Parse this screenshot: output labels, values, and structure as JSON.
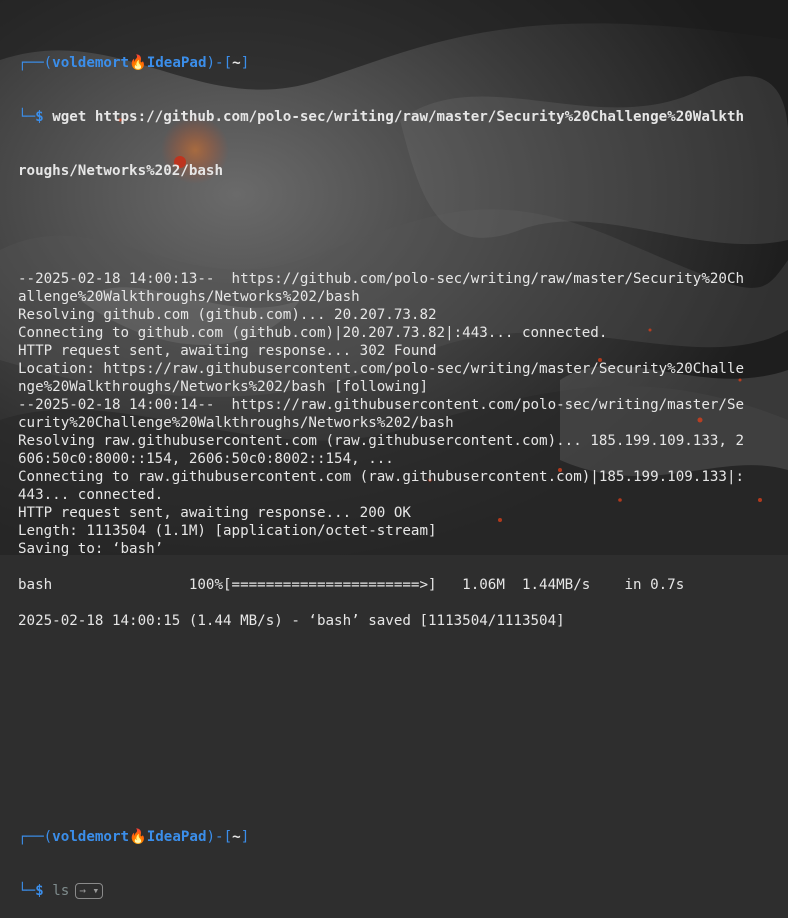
{
  "prompt1": {
    "frame_top_left": "┌──(",
    "user": "voldemort",
    "emoji": "🔥",
    "host": "IdeaPad",
    "frame_mid": ")-[",
    "cwd": "~",
    "frame_close": "]",
    "frame_bottom": "└─",
    "symbol": "$",
    "command_line1": "wget https://github.com/polo-sec/writing/raw/master/Security%20Challenge%20Walkth",
    "command_line2": "roughs/Networks%202/bash"
  },
  "output": [
    "--2025-02-18 14:00:13--  https://github.com/polo-sec/writing/raw/master/Security%20Ch",
    "allenge%20Walkthroughs/Networks%202/bash",
    "Resolving github.com (github.com)... 20.207.73.82",
    "Connecting to github.com (github.com)|20.207.73.82|:443... connected.",
    "HTTP request sent, awaiting response... 302 Found",
    "Location: https://raw.githubusercontent.com/polo-sec/writing/master/Security%20Challe",
    "nge%20Walkthroughs/Networks%202/bash [following]",
    "--2025-02-18 14:00:14--  https://raw.githubusercontent.com/polo-sec/writing/master/Se",
    "curity%20Challenge%20Walkthroughs/Networks%202/bash",
    "Resolving raw.githubusercontent.com (raw.githubusercontent.com)... 185.199.109.133, 2",
    "606:50c0:8000::154, 2606:50c0:8002::154, ...",
    "Connecting to raw.githubusercontent.com (raw.githubusercontent.com)|185.199.109.133|:",
    "443... connected.",
    "HTTP request sent, awaiting response... 200 OK",
    "Length: 1113504 (1.1M) [application/octet-stream]",
    "Saving to: ‘bash’",
    "",
    "bash                100%[======================>]   1.06M  1.44MB/s    in 0.7s",
    "",
    "2025-02-18 14:00:15 (1.44 MB/s) - ‘bash’ saved [1113504/1113504]"
  ],
  "prompt2": {
    "frame_top_left": "┌──(",
    "user": "voldemort",
    "emoji": "🔥",
    "host": "IdeaPad",
    "frame_mid": ")-[",
    "cwd": "~",
    "frame_close": "]",
    "frame_bottom": "└─",
    "symbol": "$",
    "command": "ls",
    "suggestion": "→ ▾"
  },
  "colors": {
    "prompt_blue": "#3b8eea",
    "text": "#e6e6e6",
    "ember": "#ff6a1a"
  }
}
